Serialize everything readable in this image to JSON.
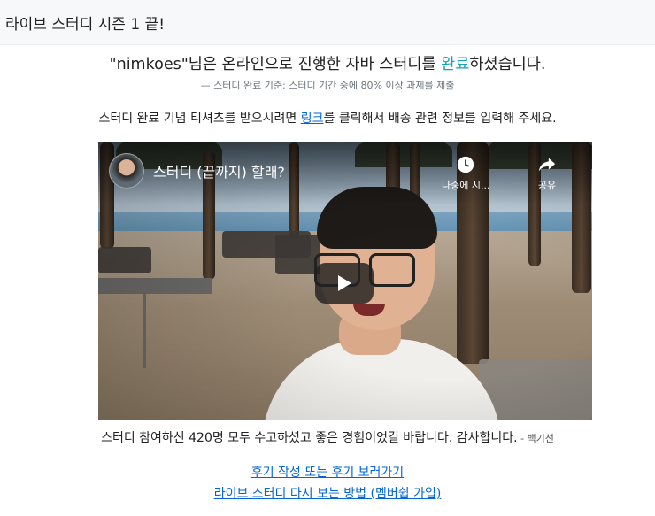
{
  "header": {
    "title": "라이브 스터디 시즌 1 끝!"
  },
  "headline": {
    "prefix": "\"nimkoes\"님은 온라인으로 진행한 자바 스터디를 ",
    "highlight": "완료",
    "suffix": "하셨습니다."
  },
  "criteria": "— 스터디 완료 기준: 스터디 기간 중에 80% 이상 과제를 제출",
  "tshirt": {
    "prefix": "스터디 완료 기념 티셔츠를 받으시려면 ",
    "link_label": "링크",
    "suffix": "를 클릭해서 배송 관련 정보를 입력해 주세요."
  },
  "video": {
    "title": "스터디 (끝까지) 할래?",
    "watch_later_label": "나중에 시...",
    "share_label": "공유"
  },
  "thanks": {
    "message": "스터디 참여하신 420명 모두 수고하셨고 좋은 경험이었길 바랍니다. 감사합니다.",
    "signature": " - 백기선"
  },
  "links": {
    "review": "후기 작성 또는 후기 보러가기",
    "replay": "라이브 스터디 다시 보는 방법 (멤버쉽 가입)"
  },
  "colors": {
    "accent_completed": "#17a2b8",
    "link": "#0366d6"
  }
}
